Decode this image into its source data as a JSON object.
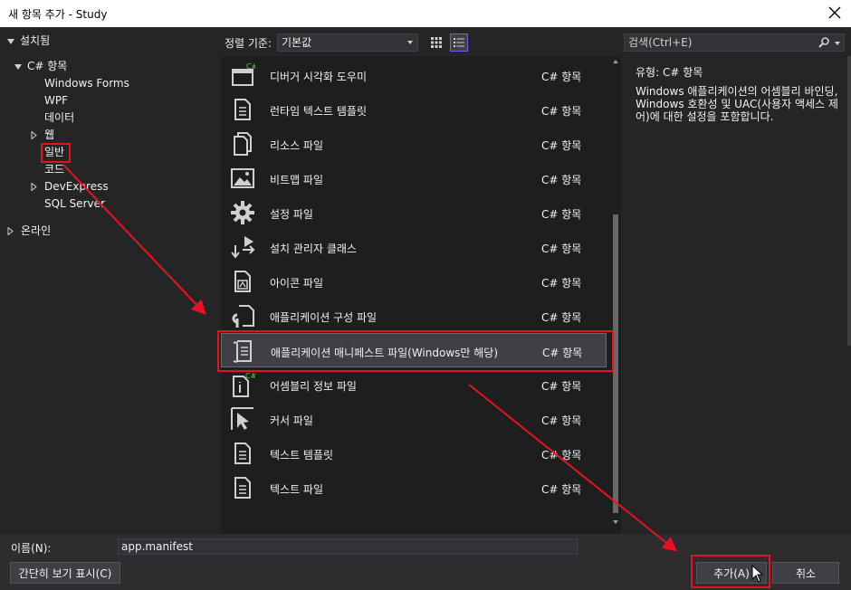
{
  "window": {
    "title": "새 항목 추가 - Study"
  },
  "tree": {
    "installed": "설치됨",
    "csharp_items": "C# 항목",
    "children": [
      "Windows Forms",
      "WPF",
      "데이터",
      "웹",
      "일반",
      "코드",
      "DevExpress",
      "SQL Server"
    ],
    "online": "온라인"
  },
  "toolbar": {
    "sort_label": "정렬 기준:",
    "sort_value": "기본값"
  },
  "search": {
    "placeholder": "검색(Ctrl+E)"
  },
  "items": [
    {
      "name": "디버거 시각화 도우미",
      "type": "C# 항목",
      "icon": "debugger-visualizer-icon"
    },
    {
      "name": "런타임 텍스트 템플릿",
      "type": "C# 항목",
      "icon": "runtime-text-template-icon"
    },
    {
      "name": "리소스 파일",
      "type": "C# 항목",
      "icon": "resource-file-icon"
    },
    {
      "name": "비트맵 파일",
      "type": "C# 항목",
      "icon": "bitmap-file-icon"
    },
    {
      "name": "설정 파일",
      "type": "C# 항목",
      "icon": "settings-gear-icon"
    },
    {
      "name": "설치 관리자 클래스",
      "type": "C# 항목",
      "icon": "installer-class-icon"
    },
    {
      "name": "아이콘 파일",
      "type": "C# 항목",
      "icon": "icon-file-icon"
    },
    {
      "name": "애플리케이션 구성 파일",
      "type": "C# 항목",
      "icon": "app-config-icon"
    },
    {
      "name": "애플리케이션 매니페스트 파일(Windows만 해당)",
      "type": "C# 항목",
      "icon": "app-manifest-icon"
    },
    {
      "name": "어셈블리 정보 파일",
      "type": "C# 항목",
      "icon": "assembly-info-icon"
    },
    {
      "name": "커서 파일",
      "type": "C# 항목",
      "icon": "cursor-file-icon"
    },
    {
      "name": "텍스트 템플릿",
      "type": "C# 항목",
      "icon": "text-template-icon"
    },
    {
      "name": "텍스트 파일",
      "type": "C# 항목",
      "icon": "text-file-icon"
    }
  ],
  "info": {
    "type_label": "유형:",
    "type_value": "C# 항목",
    "description": "Windows 애플리케이션의 어셈블리 바인딩, Windows 호환성 및 UAC(사용자 액세스 제어)에 대한 설정을 포함합니다."
  },
  "bottom": {
    "name_label": "이름(N):",
    "name_value": "app.manifest",
    "compact_view": "간단히 보기 표시(C)",
    "add": "추가(A)",
    "cancel": "취소"
  },
  "colors": {
    "highlight": "#e81123",
    "accent": "#7160e8"
  }
}
